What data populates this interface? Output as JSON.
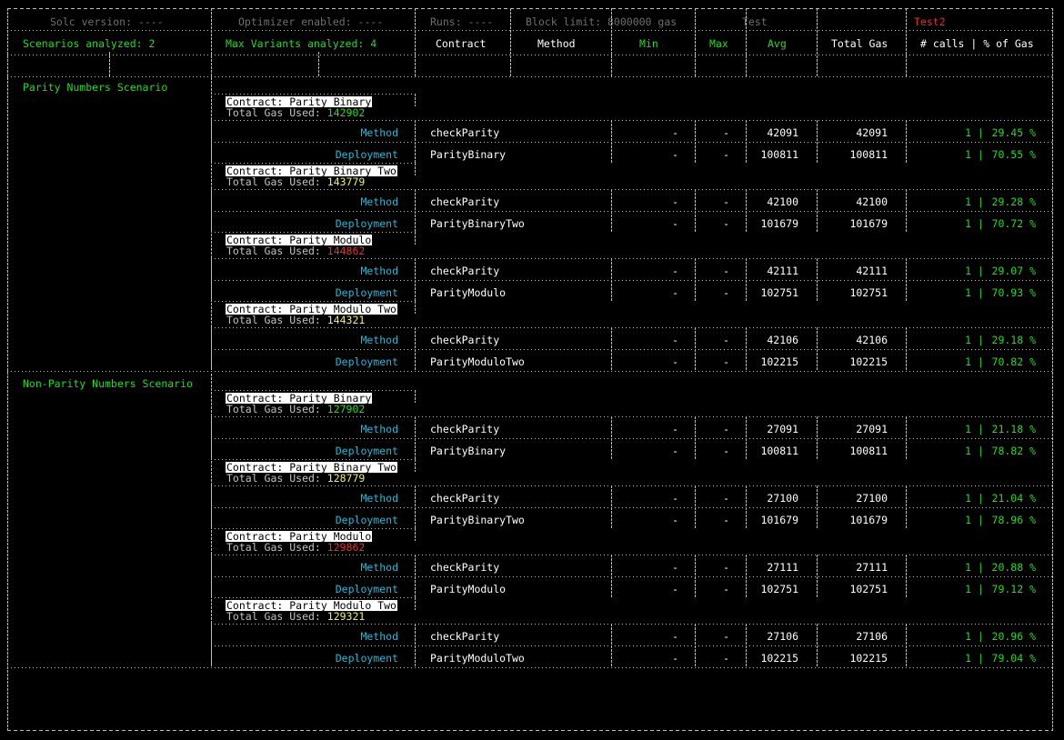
{
  "header": {
    "solc": "Solc version: ----",
    "optimizer": "Optimizer enabled: ----",
    "runs": "Runs: ----",
    "block_limit": "Block limit: 8000000 gas",
    "test": "Test",
    "test2": "Test2"
  },
  "columns": {
    "scenarios": "Scenarios analyzed: 2",
    "variants": "Max Variants analyzed: 4",
    "contract": "Contract",
    "method": "Method",
    "min": "Min",
    "max": "Max",
    "avg": "Avg",
    "total_gas": "Total Gas",
    "calls_pct": "# calls | % of Gas"
  },
  "labels": {
    "contract_prefix": "Contract: ",
    "total_gas_prefix": "Total Gas Used: ",
    "method": "Method",
    "deployment": "Deployment",
    "dash": "-",
    "sep": " | "
  },
  "colors": {
    "green": "#22dd22",
    "cyan": "#22b8d8",
    "red": "#e03030",
    "yellow": "#f0f050",
    "gray": "#6e6e6e"
  },
  "scenarios": [
    {
      "name": "Parity Numbers Scenario",
      "contracts": [
        {
          "name": "Parity_Binary",
          "total_gas": "142902",
          "gas_color": "green",
          "rows": [
            {
              "type": "Method",
              "contract": "checkParity",
              "min": "-",
              "max": "-",
              "avg": "42091",
              "total": "42091",
              "calls": "1",
              "pct": "29.45 %"
            },
            {
              "type": "Deployment",
              "contract": "ParityBinary",
              "min": "-",
              "max": "-",
              "avg": "100811",
              "total": "100811",
              "calls": "1",
              "pct": "70.55 %"
            }
          ]
        },
        {
          "name": "Parity_Binary_Two",
          "total_gas": "143779",
          "gas_color": "yellow",
          "rows": [
            {
              "type": "Method",
              "contract": "checkParity",
              "min": "-",
              "max": "-",
              "avg": "42100",
              "total": "42100",
              "calls": "1",
              "pct": "29.28 %"
            },
            {
              "type": "Deployment",
              "contract": "ParityBinaryTwo",
              "min": "-",
              "max": "-",
              "avg": "101679",
              "total": "101679",
              "calls": "1",
              "pct": "70.72 %"
            }
          ]
        },
        {
          "name": "Parity_Modulo",
          "total_gas": "144862",
          "gas_color": "red",
          "rows": [
            {
              "type": "Method",
              "contract": "checkParity",
              "min": "-",
              "max": "-",
              "avg": "42111",
              "total": "42111",
              "calls": "1",
              "pct": "29.07 %"
            },
            {
              "type": "Deployment",
              "contract": "ParityModulo",
              "min": "-",
              "max": "-",
              "avg": "102751",
              "total": "102751",
              "calls": "1",
              "pct": "70.93 %"
            }
          ]
        },
        {
          "name": "Parity_Modulo_Two",
          "total_gas": "144321",
          "gas_color": "yellow",
          "rows": [
            {
              "type": "Method",
              "contract": "checkParity",
              "min": "-",
              "max": "-",
              "avg": "42106",
              "total": "42106",
              "calls": "1",
              "pct": "29.18 %"
            },
            {
              "type": "Deployment",
              "contract": "ParityModuloTwo",
              "min": "-",
              "max": "-",
              "avg": "102215",
              "total": "102215",
              "calls": "1",
              "pct": "70.82 %"
            }
          ]
        }
      ]
    },
    {
      "name": "Non-Parity Numbers Scenario",
      "contracts": [
        {
          "name": "Parity_Binary",
          "total_gas": "127902",
          "gas_color": "green",
          "rows": [
            {
              "type": "Method",
              "contract": "checkParity",
              "min": "-",
              "max": "-",
              "avg": "27091",
              "total": "27091",
              "calls": "1",
              "pct": "21.18 %"
            },
            {
              "type": "Deployment",
              "contract": "ParityBinary",
              "min": "-",
              "max": "-",
              "avg": "100811",
              "total": "100811",
              "calls": "1",
              "pct": "78.82 %"
            }
          ]
        },
        {
          "name": "Parity_Binary_Two",
          "total_gas": "128779",
          "gas_color": "yellow",
          "rows": [
            {
              "type": "Method",
              "contract": "checkParity",
              "min": "-",
              "max": "-",
              "avg": "27100",
              "total": "27100",
              "calls": "1",
              "pct": "21.04 %"
            },
            {
              "type": "Deployment",
              "contract": "ParityBinaryTwo",
              "min": "-",
              "max": "-",
              "avg": "101679",
              "total": "101679",
              "calls": "1",
              "pct": "78.96 %"
            }
          ]
        },
        {
          "name": "Parity_Modulo",
          "total_gas": "129862",
          "gas_color": "red",
          "rows": [
            {
              "type": "Method",
              "contract": "checkParity",
              "min": "-",
              "max": "-",
              "avg": "27111",
              "total": "27111",
              "calls": "1",
              "pct": "20.88 %"
            },
            {
              "type": "Deployment",
              "contract": "ParityModulo",
              "min": "-",
              "max": "-",
              "avg": "102751",
              "total": "102751",
              "calls": "1",
              "pct": "79.12 %"
            }
          ]
        },
        {
          "name": "Parity_Modulo_Two",
          "total_gas": "129321",
          "gas_color": "yellow",
          "rows": [
            {
              "type": "Method",
              "contract": "checkParity",
              "min": "-",
              "max": "-",
              "avg": "27106",
              "total": "27106",
              "calls": "1",
              "pct": "20.96 %"
            },
            {
              "type": "Deployment",
              "contract": "ParityModuloTwo",
              "min": "-",
              "max": "-",
              "avg": "102215",
              "total": "102215",
              "calls": "1",
              "pct": "79.04 %"
            }
          ]
        }
      ]
    }
  ]
}
